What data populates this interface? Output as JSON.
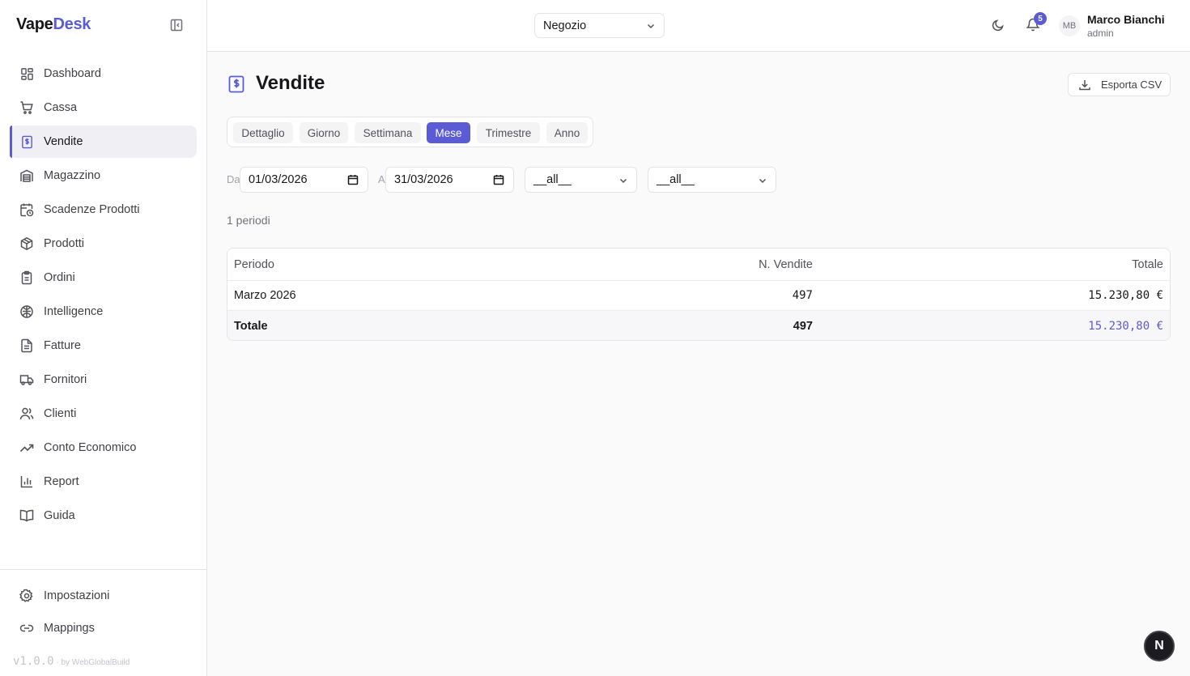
{
  "brand": {
    "part1": "Vape",
    "part2": "Desk"
  },
  "sidebar": {
    "items": [
      {
        "label": "Dashboard",
        "icon": "dashboard-icon"
      },
      {
        "label": "Cassa",
        "icon": "cart-icon"
      },
      {
        "label": "Vendite",
        "icon": "receipt-icon",
        "active": true
      },
      {
        "label": "Magazzino",
        "icon": "warehouse-icon"
      },
      {
        "label": "Scadenze Prodotti",
        "icon": "calendar-clock-icon"
      },
      {
        "label": "Prodotti",
        "icon": "box-icon"
      },
      {
        "label": "Ordini",
        "icon": "clipboard-icon"
      },
      {
        "label": "Intelligence",
        "icon": "brain-icon"
      },
      {
        "label": "Fatture",
        "icon": "file-icon"
      },
      {
        "label": "Fornitori",
        "icon": "truck-icon"
      },
      {
        "label": "Clienti",
        "icon": "users-icon"
      },
      {
        "label": "Conto Economico",
        "icon": "trend-icon"
      },
      {
        "label": "Report",
        "icon": "bar-chart-icon"
      },
      {
        "label": "Guida",
        "icon": "book-icon"
      }
    ],
    "bottom": [
      {
        "label": "Impostazioni",
        "icon": "gear-icon"
      },
      {
        "label": "Mappings",
        "icon": "link-icon"
      }
    ],
    "version": "v1.0.0",
    "by": "· by WebGlobalBuild"
  },
  "topbar": {
    "store": "Negozio",
    "notifications": "5",
    "user": {
      "initials": "MB",
      "name": "Marco Bianchi",
      "role": "admin"
    }
  },
  "page": {
    "title": "Vendite",
    "export_label": "Esporta CSV",
    "tabs": [
      "Dettaglio",
      "Giorno",
      "Settimana",
      "Mese",
      "Trimestre",
      "Anno"
    ],
    "active_tab": "Mese",
    "filters": {
      "from_label": "Da",
      "from_value": "01/03/2026",
      "to_label": "A",
      "to_value": "31/03/2026",
      "select1": "__all__",
      "select2": "__all__"
    },
    "count": "1 periodi",
    "table": {
      "headers": [
        "Periodo",
        "N. Vendite",
        "Totale"
      ],
      "rows": [
        {
          "periodo": "Marzo 2026",
          "vendite": "497",
          "totale": "15.230,80 €"
        }
      ],
      "total": {
        "label": "Totale",
        "vendite": "497",
        "totale": "15.230,80 €"
      }
    }
  },
  "colors": {
    "accent": "#5b5bd6"
  },
  "fab": "N"
}
